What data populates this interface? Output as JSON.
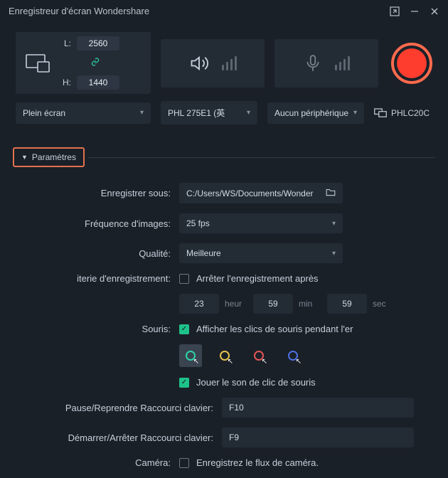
{
  "window": {
    "title": "Enregistreur d'écran Wondershare"
  },
  "capture": {
    "width_label": "L:",
    "width": "2560",
    "height_label": "H:",
    "height": "1440"
  },
  "selectors": {
    "region": "Plein écran",
    "audio": "PHL 275E1 (英",
    "mic": "Aucun périphérique",
    "display": "PHLC20C"
  },
  "params": {
    "tab_label": "Paramètres",
    "save_to_label": "Enregistrer sous:",
    "save_to_path": "C:/Users/WS/Documents/Wonder",
    "fps_label": "Fréquence d'images:",
    "fps_value": "25 fps",
    "quality_label": "Qualité:",
    "quality_value": "Meilleure",
    "timer_label": "iterie d'enregistrement:",
    "timer_check": "Arrêter l'enregistrement après",
    "timer_h": "23",
    "timer_h_u": "heur",
    "timer_m": "59",
    "timer_m_u": "min",
    "timer_s": "59",
    "timer_s_u": "sec",
    "mouse_label": "Souris:",
    "mouse_show": "Afficher les clics de souris pendant l'er",
    "mouse_sound": "Jouer le son de clic de souris",
    "hotkey_pause_label": "Pause/Reprendre Raccourci clavier:",
    "hotkey_pause": "F10",
    "hotkey_start_label": "Démarrer/Arrêter Raccourci clavier:",
    "hotkey_start": "F9",
    "camera_label": "Caméra:",
    "camera_check": "Enregistrez le flux de caméra."
  }
}
